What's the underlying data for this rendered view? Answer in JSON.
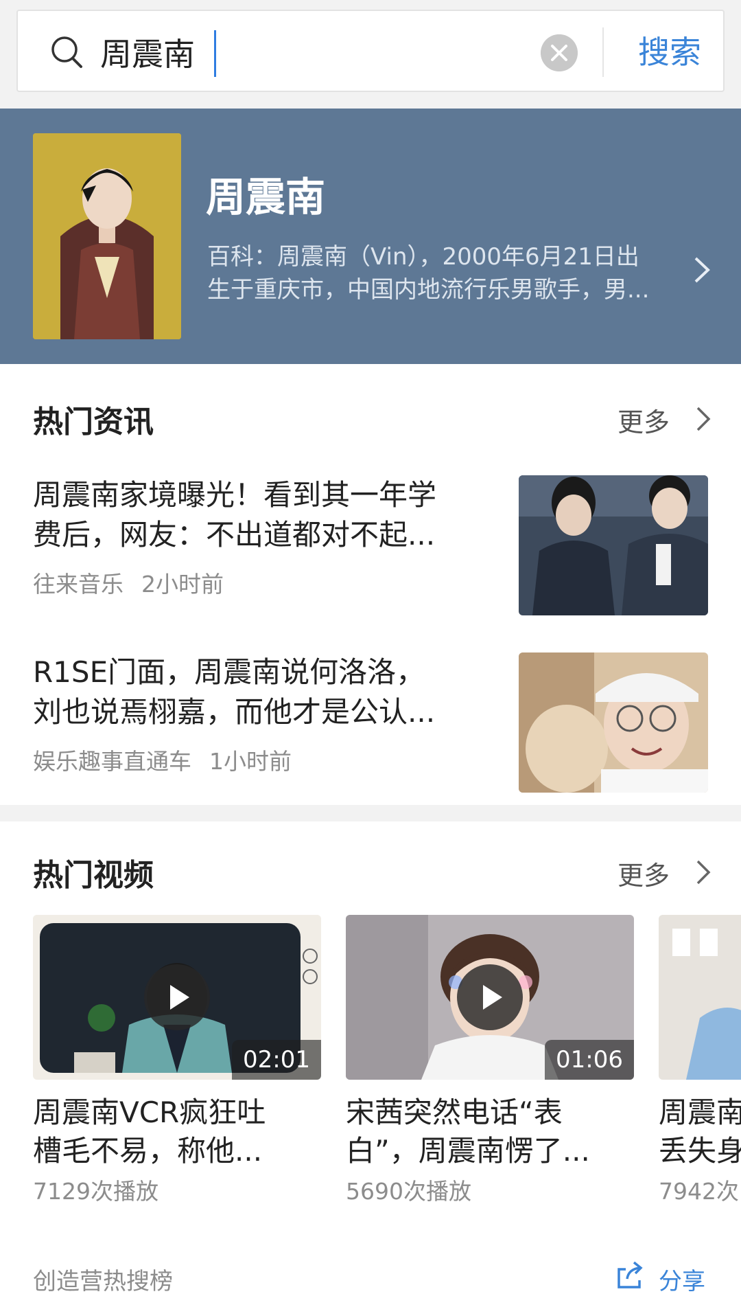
{
  "search": {
    "query": "周震南",
    "placeholder": "",
    "button_label": "搜索"
  },
  "profile": {
    "name": "周震南",
    "desc_line1": "百科：周震南（Vin），2000年6月21日出",
    "desc_line2": "生于重庆市，中国内地流行乐男歌手，男..."
  },
  "news_section": {
    "title": "热门资讯",
    "more_label": "更多",
    "items": [
      {
        "title_line1": "周震南家境曝光！看到其一年学",
        "title_line2": "费后，网友：不出道都对不起...",
        "source": "往来音乐",
        "time": "2小时前"
      },
      {
        "title_line1": "R1SE门面，周震南说何洛洛，",
        "title_line2": "刘也说焉栩嘉，而他才是公认...",
        "source": "娱乐趣事直通车",
        "time": "1小时前"
      }
    ]
  },
  "video_section": {
    "title": "热门视频",
    "more_label": "更多",
    "items": [
      {
        "duration": "02:01",
        "title_line1": "周震南VCR疯狂吐",
        "title_line2": "槽毛不易，称他...",
        "plays": "7129次播放"
      },
      {
        "duration": "01:06",
        "title_line1": "宋茜突然电话“表",
        "title_line2": "白”，周震南愣了...",
        "plays": "5690次播放"
      },
      {
        "duration": "",
        "title_line1": "周震南",
        "title_line2": "丢失身",
        "plays": "7942次"
      }
    ]
  },
  "footer": {
    "label": "创造营热搜榜",
    "share_label": "分享"
  },
  "colors": {
    "accent": "#3a84d8",
    "profile_bg": "#5e7895"
  }
}
